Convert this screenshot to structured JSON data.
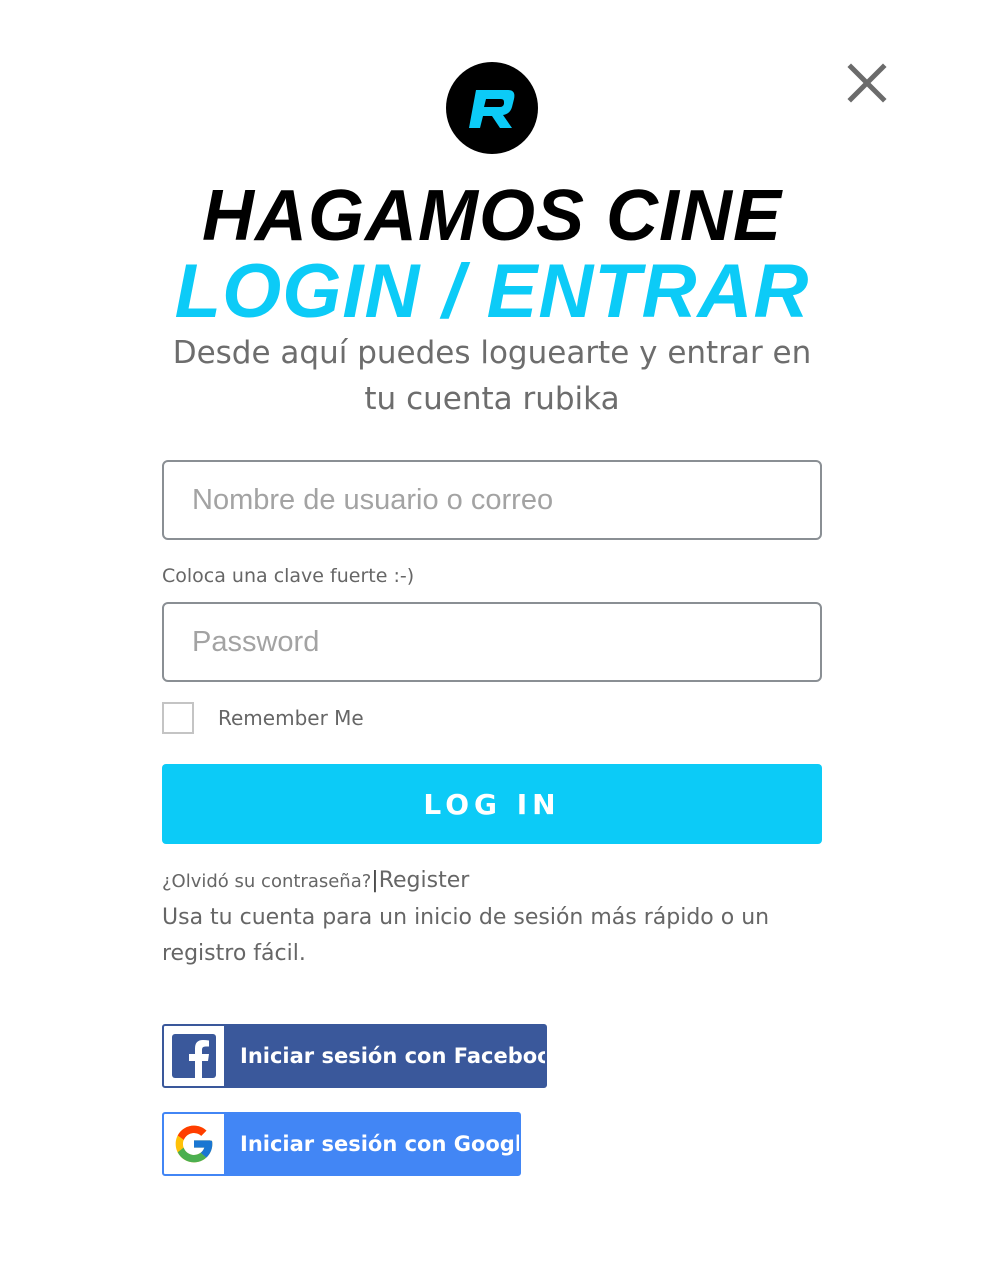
{
  "header": {
    "logo_icon": "rubika-r-logo-icon",
    "close_icon": "close-icon",
    "title_line1": "HAGAMOS CINE",
    "title_line2": "LOGIN / ENTRAR",
    "subtitle": "Desde aquí puedes loguearte y entrar en tu cuenta rubika"
  },
  "form": {
    "username_placeholder": "Nombre de usuario o correo",
    "username_value": "",
    "password_hint": "Coloca una clave fuerte :-)",
    "password_placeholder": "Password",
    "password_value": "",
    "remember_label": "Remember Me",
    "remember_checked": false,
    "login_button": "LOG IN"
  },
  "links": {
    "forgot": "¿Olvidó su contraseña?",
    "separator": "|",
    "register": "Register"
  },
  "social": {
    "note": "Usa tu cuenta para un inicio de sesión más rápido o un registro fácil.",
    "facebook_label": "Iniciar sesión con Facebook",
    "facebook_icon": "facebook-icon",
    "google_label": "Iniciar sesión con Google",
    "google_icon": "google-icon"
  },
  "colors": {
    "accent": "#0ccbf7",
    "facebook": "#3a589b",
    "google": "#4286f5",
    "text_muted": "#666666"
  }
}
